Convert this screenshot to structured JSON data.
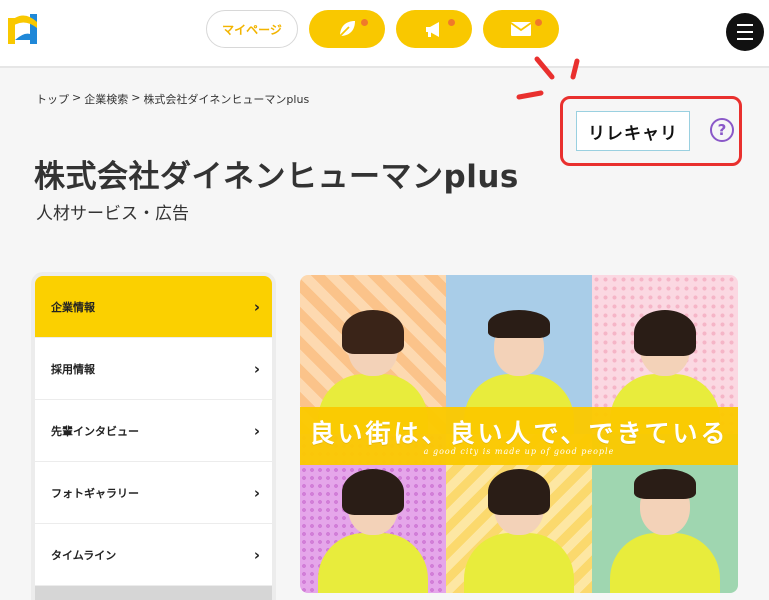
{
  "header": {
    "logo_icon": "h-logo-icon",
    "mypage_label": "マイページ",
    "pills": [
      {
        "icon": "leaf-icon"
      },
      {
        "icon": "megaphone-icon"
      },
      {
        "icon": "mail-icon"
      }
    ],
    "menu_icon": "hamburger-icon"
  },
  "breadcrumb": [
    "トップ",
    "企業検索",
    "株式会社ダイネンヒューマンplus"
  ],
  "breadcrumb_sep": ">",
  "company": {
    "name": "株式会社ダイネンヒューマンplus",
    "industry": "人材サービス・広告"
  },
  "badge": {
    "label": "リレキャリ",
    "help": "?"
  },
  "sidebar": {
    "items": [
      {
        "label": "企業情報",
        "active": true
      },
      {
        "label": "採用情報",
        "active": false
      },
      {
        "label": "先輩インタビュー",
        "active": false
      },
      {
        "label": "フォトギャラリー",
        "active": false
      },
      {
        "label": "タイムライン",
        "active": false
      }
    ],
    "chevron": "›"
  },
  "hero": {
    "slogan": "良い街は、良い人で、できている",
    "sub": "a good city is made up of good people"
  },
  "colors": {
    "brand_yellow": "#f9c800",
    "accent_red": "#e9302e",
    "help_purple": "#8a58c8",
    "notification_dot": "#f07a2a"
  }
}
